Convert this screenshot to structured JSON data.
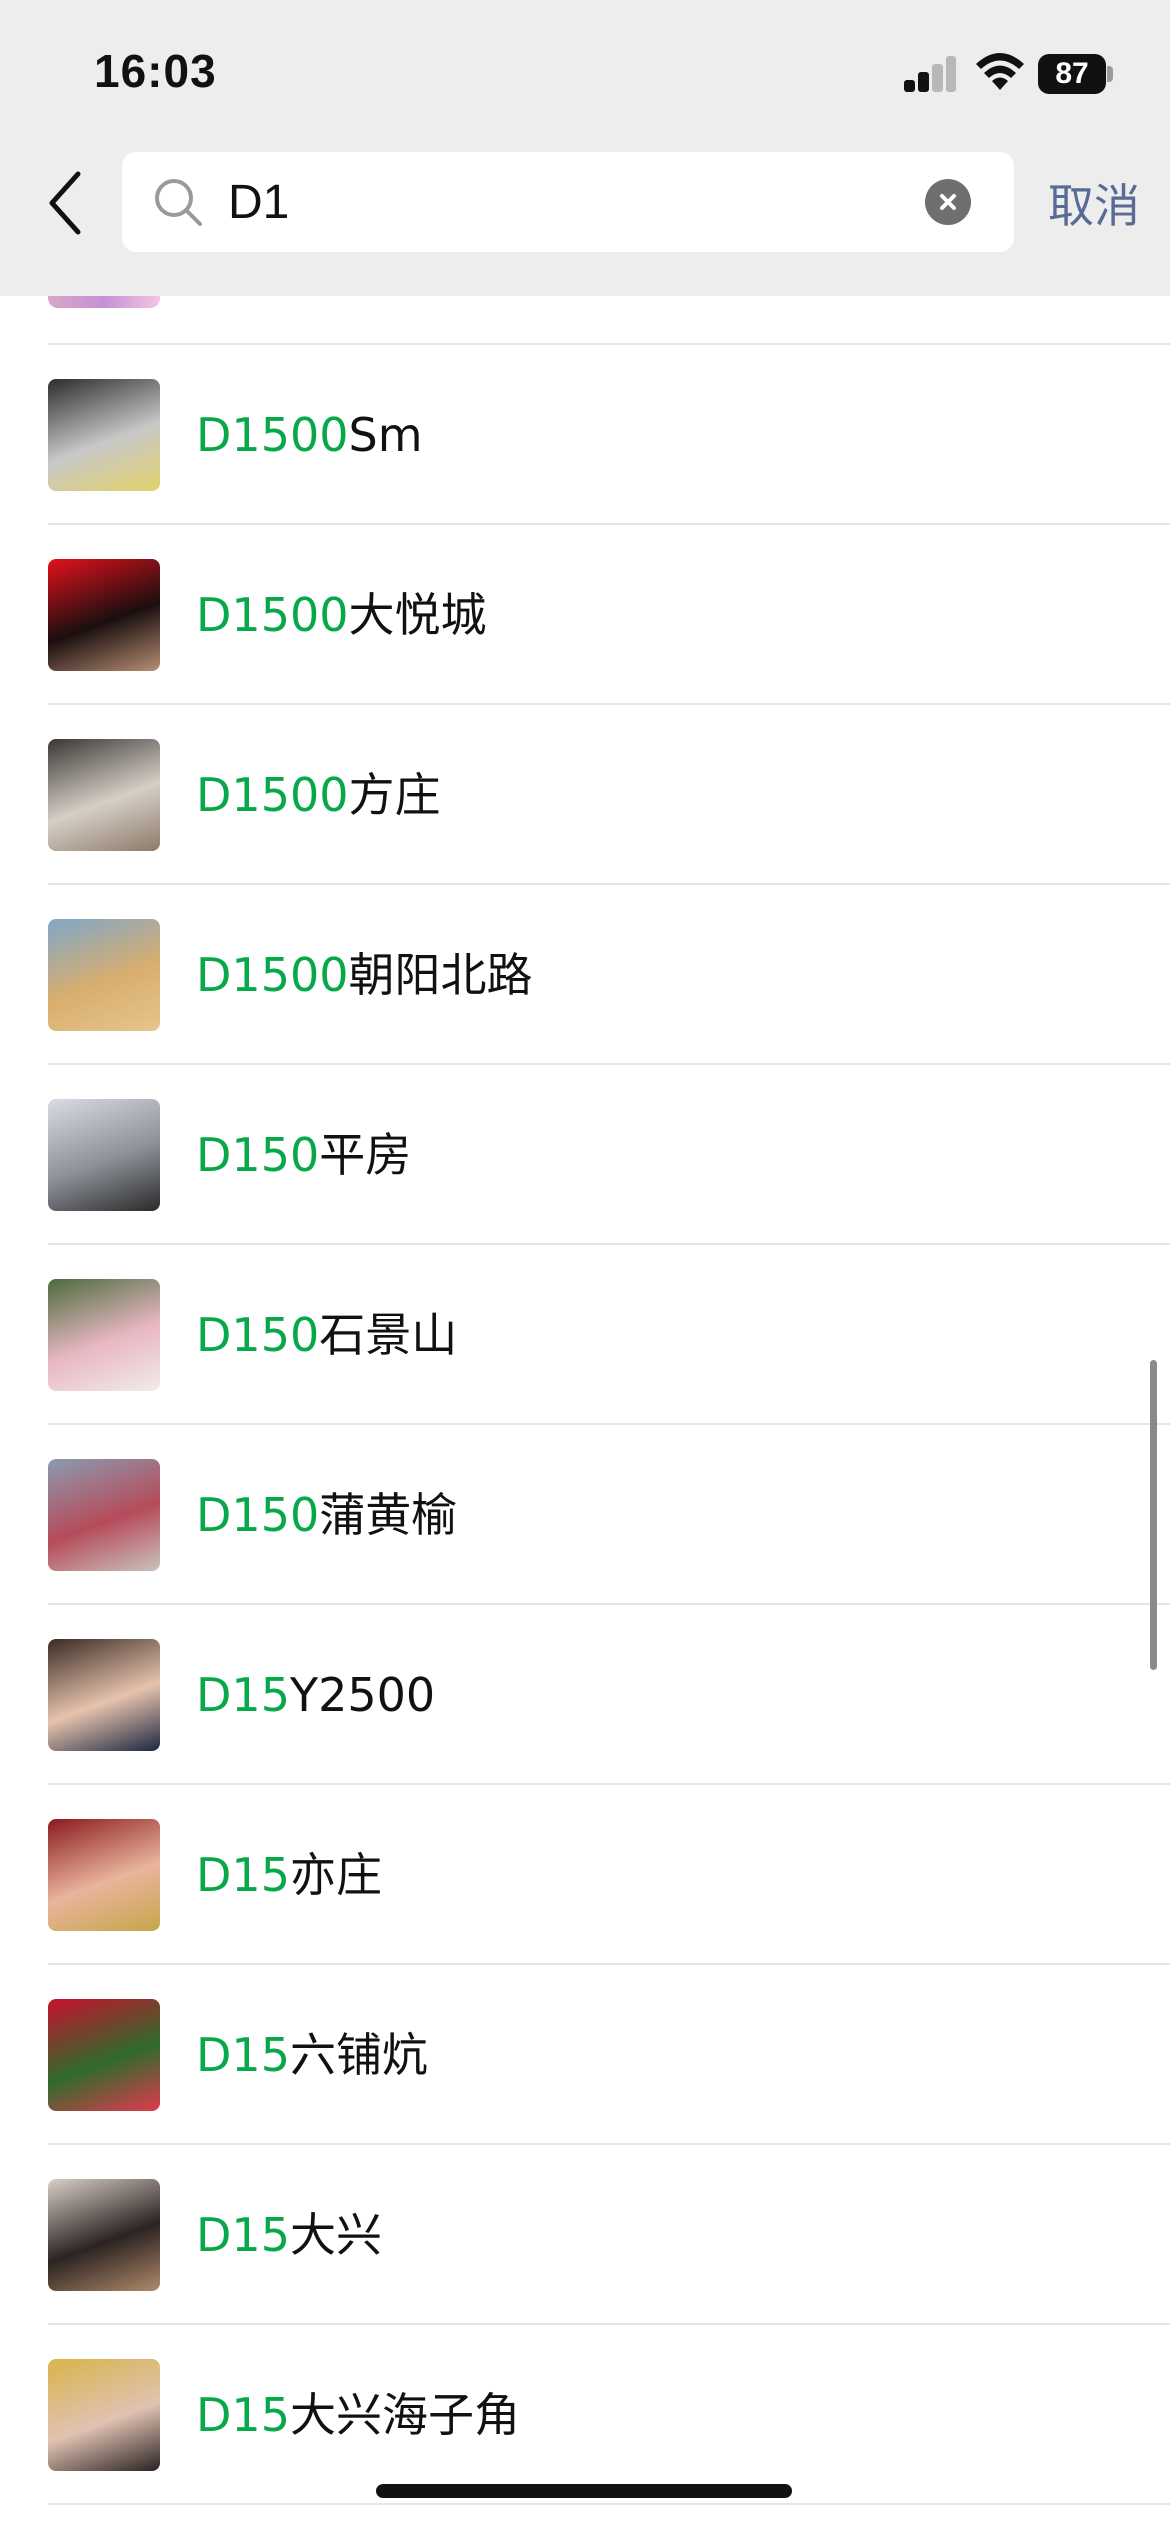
{
  "status_bar": {
    "time": "16:03",
    "battery": "87"
  },
  "search": {
    "query": "D1",
    "cancel_label": "取消"
  },
  "results": [
    {
      "highlight": "D1500",
      "rest": "Sm",
      "avatar_colors": [
        "#2c2c2c",
        "#c8c8c8",
        "#e2d16a"
      ]
    },
    {
      "highlight": "D1500",
      "rest": "大悦城",
      "avatar_colors": [
        "#e3101c",
        "#1a0f0f",
        "#b88f74"
      ]
    },
    {
      "highlight": "D1500",
      "rest": "方庄",
      "avatar_colors": [
        "#3a3734",
        "#d6cfc6",
        "#8c7a6a"
      ]
    },
    {
      "highlight": "D1500",
      "rest": "朝阳北路",
      "avatar_colors": [
        "#7fa7c8",
        "#d9ae6e",
        "#e6c58d"
      ]
    },
    {
      "highlight": "D150",
      "rest": "平房",
      "avatar_colors": [
        "#d9dde3",
        "#8b8f96",
        "#2a2a2a"
      ]
    },
    {
      "highlight": "D150",
      "rest": "石景山",
      "avatar_colors": [
        "#4a6b3c",
        "#e8b7c2",
        "#f1ece7"
      ]
    },
    {
      "highlight": "D150",
      "rest": "蒲黄榆",
      "avatar_colors": [
        "#8a9bb0",
        "#b64b5a",
        "#c9c3bd"
      ]
    },
    {
      "highlight": "D15",
      "rest": "Y2500",
      "avatar_colors": [
        "#3a2a24",
        "#e6c3ad",
        "#1c2740"
      ]
    },
    {
      "highlight": "D15",
      "rest": "亦庄",
      "avatar_colors": [
        "#8a1a1e",
        "#e9b49c",
        "#c6a64a"
      ]
    },
    {
      "highlight": "D15",
      "rest": "六铺炕",
      "avatar_colors": [
        "#c8102e",
        "#2f6b2b",
        "#e2394f"
      ]
    },
    {
      "highlight": "D15",
      "rest": "大兴",
      "avatar_colors": [
        "#d8cfc8",
        "#2b2321",
        "#b08a6b"
      ]
    },
    {
      "highlight": "D15",
      "rest": "大兴海子角",
      "avatar_colors": [
        "#d9b44a",
        "#e0c2b2",
        "#2a2222"
      ]
    }
  ],
  "colors": {
    "highlight": "#07a84a",
    "cancel": "#576b95",
    "header_bg": "#ededed"
  }
}
